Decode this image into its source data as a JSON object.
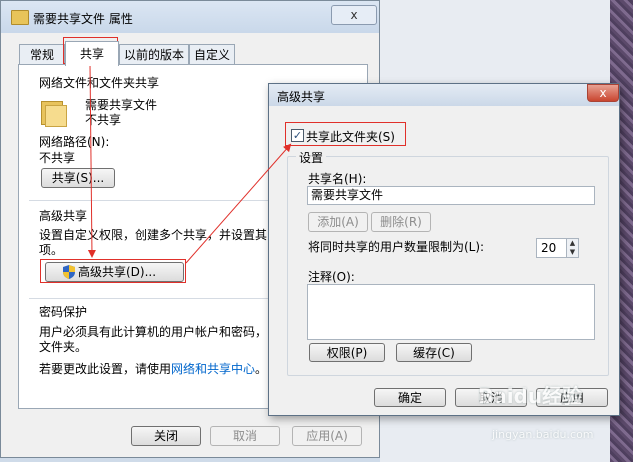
{
  "properties_window": {
    "title": "需要共享文件 属性",
    "close_label": "x",
    "tabs": [
      "常规",
      "共享",
      "以前的版本",
      "自定义"
    ],
    "section_network": "网络文件和文件夹共享",
    "folder_name": "需要共享文件",
    "folder_status": "不共享",
    "path_label": "网络路径(N):",
    "path_value": "不共享",
    "share_button": "共享(S)...",
    "section_advanced": "高级共享",
    "advanced_desc_1": "设置自定义权限，创建多个共享，并设置其",
    "advanced_desc_2": "项。",
    "advanced_button": "高级共享(D)...",
    "section_password": "密码保护",
    "password_desc_1": "用户必须具有此计算机的用户帐户和密码，",
    "password_desc_2": "文件夹。",
    "change_prefix": "若要更改此设置，请使用",
    "change_link": "网络和共享中心",
    "change_suffix": "。",
    "buttons": {
      "close": "关闭",
      "cancel": "取消",
      "apply": "应用(A)"
    }
  },
  "advanced_dialog": {
    "title": "高级共享",
    "close_label": "x",
    "share_checkbox_label": "共享此文件夹(S)",
    "share_checked": true,
    "settings_group": "设置",
    "share_name_label": "共享名(H):",
    "share_name_value": "需要共享文件",
    "add_button": "添加(A)",
    "delete_button": "删除(R)",
    "limit_label": "将同时共享的用户数量限制为(L):",
    "limit_value": "20",
    "comment_label": "注释(O):",
    "comment_value": "",
    "permissions_button": "权限(P)",
    "cache_button": "缓存(C)",
    "ok_button": "确定",
    "cancel_button": "取消",
    "apply_button": "应用"
  },
  "watermark": {
    "brand": "Baidu经验",
    "url": "jingyan.baidu.com"
  },
  "colors": {
    "annotation_red": "#e0302a",
    "link_blue": "#0066cc"
  }
}
